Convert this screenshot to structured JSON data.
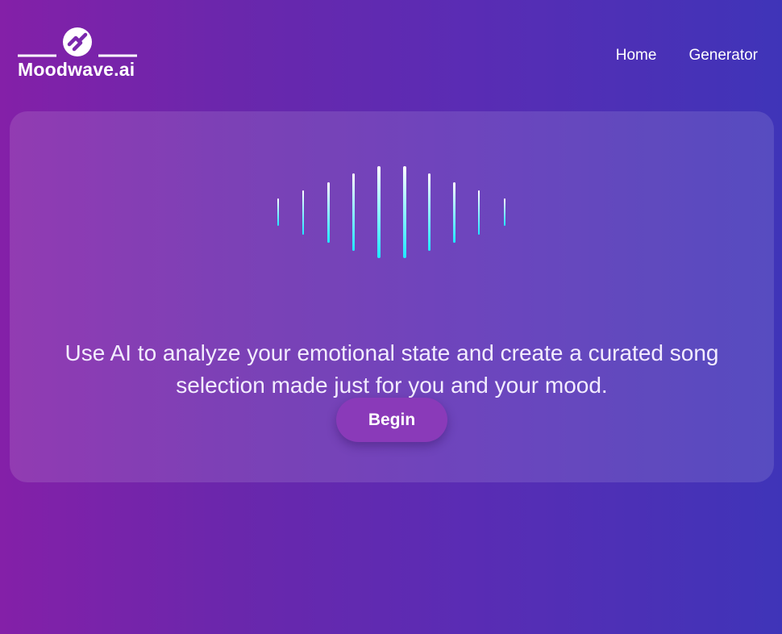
{
  "brand": {
    "name": "Moodwave.ai",
    "logo_icon": "moodwave-logo-icon"
  },
  "nav": {
    "items": [
      {
        "label": "Home"
      },
      {
        "label": "Generator"
      }
    ]
  },
  "hero": {
    "tagline": "Use AI to analyze your emotional state and create a curated song selection made just for you and your mood.",
    "begin_label": "Begin",
    "wave_icon": "soundwave-icon"
  },
  "colors": {
    "background_start": "#8420a8",
    "background_end": "#3f34b8",
    "button": "#8a3ab9",
    "wave_top": "#ffffff",
    "wave_bottom": "#1ee8ff"
  }
}
